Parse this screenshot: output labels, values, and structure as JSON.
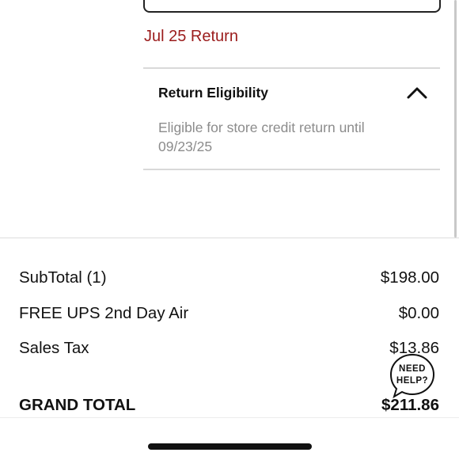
{
  "item": {
    "return_date_label": "Jul 25 Return"
  },
  "return_eligibility": {
    "title": "Return Eligibility",
    "expanded": true,
    "description": "Eligible for store credit return until 09/23/25",
    "toggle_icon": "chevron-up-icon"
  },
  "summary": {
    "rows": [
      {
        "label": "SubTotal (1)",
        "value": "$198.00"
      },
      {
        "label": "FREE UPS 2nd Day Air",
        "value": "$0.00"
      },
      {
        "label": "Sales Tax",
        "value": "$13.86"
      }
    ],
    "grand_total": {
      "label": "GRAND TOTAL",
      "value": "$211.86"
    }
  },
  "help_widget": {
    "label": "NEED HELP?",
    "icon": "speech-bubble-icon"
  },
  "colors": {
    "accent_return": "#9b1c1c",
    "muted_text": "#8c8c8c",
    "divider": "#d9d9d9"
  }
}
